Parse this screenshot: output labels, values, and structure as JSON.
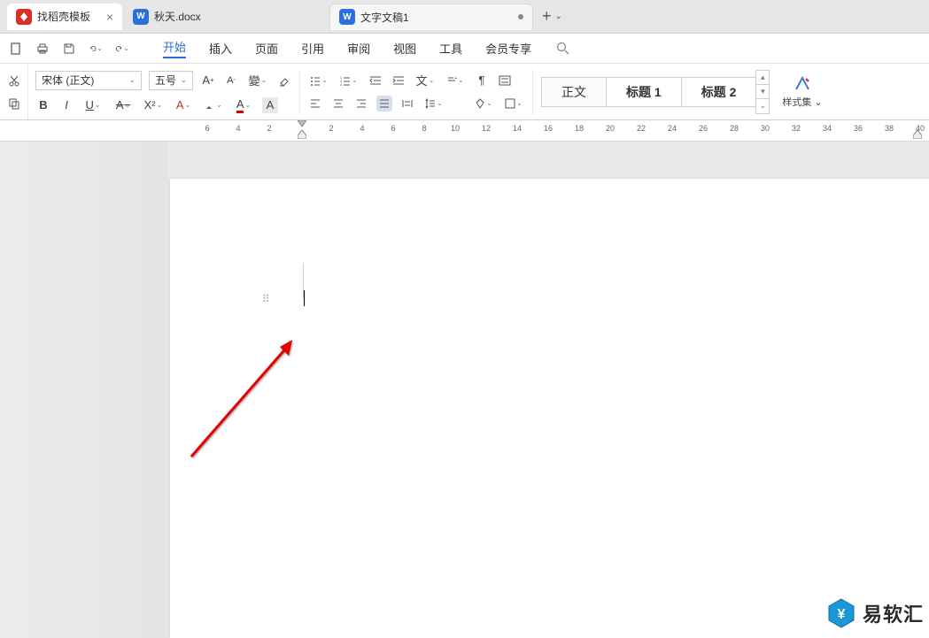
{
  "tabs": {
    "template": "找稻壳模板",
    "docx": "秋天.docx",
    "doc1": "文字文稿1"
  },
  "menu": {
    "items": [
      "开始",
      "插入",
      "页面",
      "引用",
      "审阅",
      "视图",
      "工具",
      "会员专享"
    ],
    "active_index": 0
  },
  "toolbar": {
    "font_name": "宋体 (正文)",
    "font_size": "五号"
  },
  "styles": {
    "normal": "正文",
    "h1": "标题  1",
    "h2": "标题  2",
    "styleset_label": "样式集",
    "styleset_chev": "⌄"
  },
  "ruler": {
    "left_numbers": [
      "6",
      "4",
      "2"
    ],
    "right_numbers": [
      "2",
      "4",
      "6",
      "8",
      "10",
      "12",
      "14",
      "16",
      "18",
      "20",
      "22",
      "24",
      "26",
      "28",
      "30",
      "32",
      "34",
      "36",
      "38",
      "40"
    ]
  },
  "watermark": "易软汇"
}
